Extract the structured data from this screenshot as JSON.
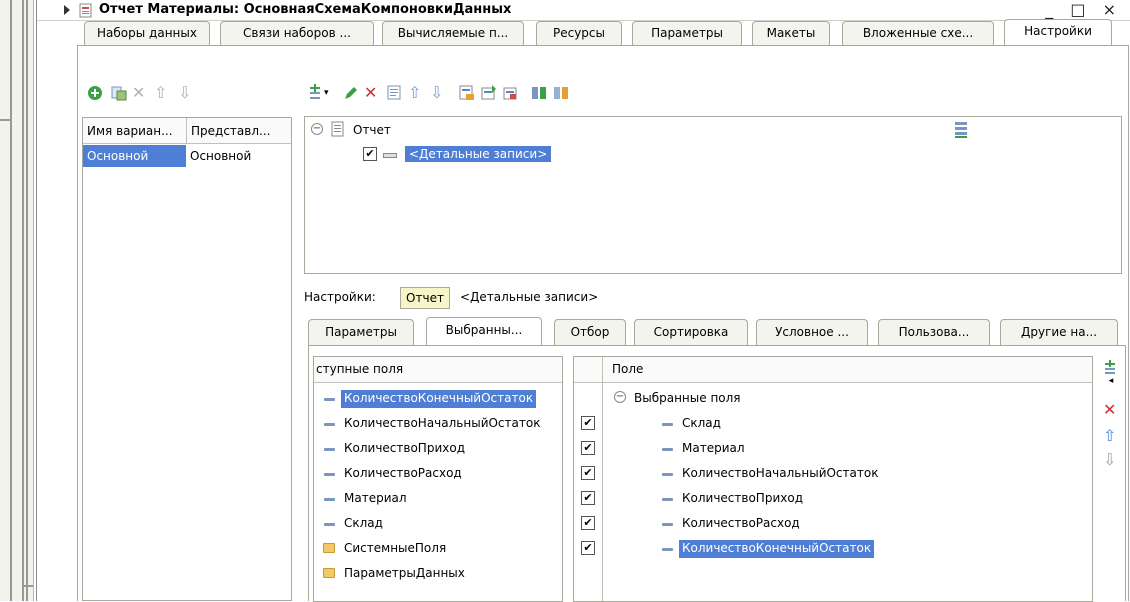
{
  "window": {
    "title": "Отчет Материалы: ОсновнаяСхемаКомпоновкиДанных",
    "controls": "_ □ ×"
  },
  "main_tabs": [
    {
      "label": "Наборы данных",
      "active": false
    },
    {
      "label": "Связи наборов ...",
      "active": false
    },
    {
      "label": "Вычисляемые п...",
      "active": false
    },
    {
      "label": "Ресурсы",
      "active": false
    },
    {
      "label": "Параметры",
      "active": false
    },
    {
      "label": "Макеты",
      "active": false
    },
    {
      "label": "Вложенные схе...",
      "active": false
    },
    {
      "label": "Настройки",
      "active": true
    }
  ],
  "variants_table": {
    "headers": [
      "Имя вариан...",
      "Представл..."
    ],
    "rows": [
      [
        "Основной",
        "Основной"
      ]
    ]
  },
  "structure_tree": {
    "root": "Отчет",
    "child": "<Детальные записи>"
  },
  "settings_line": {
    "label": "Настройки:",
    "button": "Отчет",
    "context": "<Детальные записи>"
  },
  "sub_tabs": [
    {
      "label": "Параметры",
      "active": false
    },
    {
      "label": "Выбранны...",
      "active": true
    },
    {
      "label": "Отбор",
      "active": false
    },
    {
      "label": "Сортировка",
      "active": false
    },
    {
      "label": "Условное ...",
      "active": false
    },
    {
      "label": "Пользова...",
      "active": false
    },
    {
      "label": "Другие на...",
      "active": false
    }
  ],
  "available_fields": {
    "header": "ступные поля",
    "items": [
      {
        "label": "КоличествоКонечныйОстаток",
        "kind": "field",
        "selected": true
      },
      {
        "label": "КоличествоНачальныйОстаток",
        "kind": "field",
        "selected": false
      },
      {
        "label": "КоличествоПриход",
        "kind": "field",
        "selected": false
      },
      {
        "label": "КоличествоРасход",
        "kind": "field",
        "selected": false
      },
      {
        "label": "Материал",
        "kind": "field",
        "selected": false
      },
      {
        "label": "Склад",
        "kind": "field",
        "selected": false
      },
      {
        "label": "СистемныеПоля",
        "kind": "folder",
        "selected": false
      },
      {
        "label": "ПараметрыДанных",
        "kind": "folder",
        "selected": false
      }
    ]
  },
  "selected_fields": {
    "header": "Поле",
    "group": "Выбранные поля",
    "items": [
      {
        "label": "Склад",
        "checked": true,
        "selected": false
      },
      {
        "label": "Материал",
        "checked": true,
        "selected": false
      },
      {
        "label": "КоличествоНачальныйОстаток",
        "checked": true,
        "selected": false
      },
      {
        "label": "КоличествоПриход",
        "checked": true,
        "selected": false
      },
      {
        "label": "КоличествоРасход",
        "checked": true,
        "selected": false
      },
      {
        "label": "КоличествоКонечныйОстаток",
        "checked": true,
        "selected": true
      }
    ]
  },
  "colors": {
    "selection": "#4f7fd4",
    "tab_bg": "#f4f4ee",
    "border": "#a8a89c"
  }
}
